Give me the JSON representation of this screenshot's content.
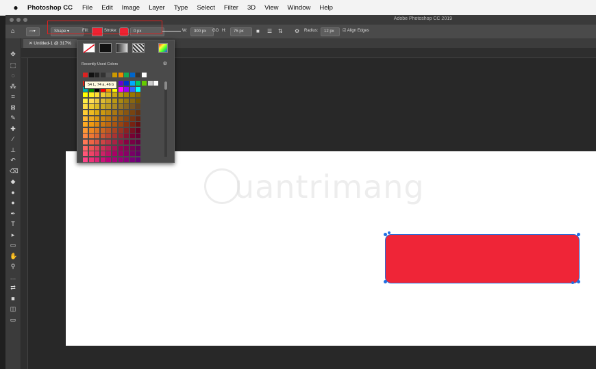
{
  "menubar": {
    "app_name": "Photoshop CC",
    "items": [
      "File",
      "Edit",
      "Image",
      "Layer",
      "Type",
      "Select",
      "Filter",
      "3D",
      "View",
      "Window",
      "Help"
    ]
  },
  "window": {
    "title": "Adobe Photoshop CC 2019"
  },
  "options_bar": {
    "mode_select": "Shape",
    "fill_label": "Fill:",
    "fill_color": "#ee2233",
    "stroke_label": "Stroke:",
    "stroke_color": "#ee2233",
    "stroke_width": "0 px",
    "width_label": "W:",
    "width_value": "300 px",
    "link_label": "GO",
    "height_label": "H:",
    "height_value": "75 px",
    "radius_label": "Radius:",
    "radius_value": "12 px",
    "align_edges_label": "Align Edges"
  },
  "document_tab": {
    "label": "Untitled-1 @ 317%"
  },
  "color_popup": {
    "recent_label": "Recently Used Colors",
    "tooltip": "54 L, 74 a, 46 b",
    "recent_colors": [
      "#d22",
      "#111",
      "#222",
      "#333",
      "#555",
      "#c90",
      "#e80",
      "#1a5",
      "#06c",
      "#333",
      "#fff"
    ],
    "palette_rows": [
      [
        "#e21",
        "#f60",
        "#fc0",
        "#ff0",
        "#f0c",
        "#c0f",
        "#60c",
        "#03c",
        "#0af",
        "#0c6",
        "#6c0",
        "#ccc",
        "#fff",
        "#000",
        "#fa0"
      ],
      [
        "#0aa",
        "#080",
        "#000",
        "#f00",
        "#f90",
        "#ff0",
        "#f0f",
        "#90f",
        "#36f",
        "#0ff"
      ],
      [
        "#ff0",
        "#fe2",
        "#fd3",
        "#ec3",
        "#db2",
        "#ca1",
        "#b91",
        "#a80",
        "#970",
        "#860"
      ],
      [
        "#fe4",
        "#fd5",
        "#ec4",
        "#db3",
        "#ca2",
        "#b91",
        "#a81",
        "#971",
        "#861",
        "#750"
      ],
      [
        "#fd4",
        "#ec3",
        "#db2",
        "#ca2",
        "#b92",
        "#a82",
        "#972",
        "#862",
        "#752",
        "#642"
      ],
      [
        "#fc3",
        "#eb2",
        "#da1",
        "#c91",
        "#b81",
        "#a71",
        "#961",
        "#851",
        "#741",
        "#631"
      ],
      [
        "#fb3",
        "#ea2",
        "#d91",
        "#c81",
        "#b71",
        "#a61",
        "#951",
        "#841",
        "#731",
        "#621"
      ],
      [
        "#fa2",
        "#e91",
        "#d81",
        "#c71",
        "#b61",
        "#a51",
        "#941",
        "#831",
        "#721",
        "#611"
      ],
      [
        "#f93",
        "#e82",
        "#d72",
        "#c62",
        "#b52",
        "#a42",
        "#932",
        "#822",
        "#712",
        "#602"
      ],
      [
        "#f84",
        "#e73",
        "#d63",
        "#c53",
        "#b43",
        "#a33",
        "#923",
        "#813",
        "#703",
        "#603"
      ],
      [
        "#f75",
        "#e64",
        "#d54",
        "#c44",
        "#b34",
        "#a24",
        "#914",
        "#804",
        "#704",
        "#604"
      ],
      [
        "#f66",
        "#e55",
        "#d45",
        "#c35",
        "#b25",
        "#a15",
        "#905",
        "#805",
        "#705",
        "#605"
      ],
      [
        "#f57",
        "#e46",
        "#d36",
        "#c26",
        "#b16",
        "#a06",
        "#906",
        "#806",
        "#706",
        "#606"
      ],
      [
        "#f48",
        "#e37",
        "#d27",
        "#c17",
        "#b07",
        "#a07",
        "#907",
        "#807",
        "#707",
        "#607"
      ]
    ]
  },
  "canvas": {
    "background": "#ffffff",
    "shape_fill": "#ef2537",
    "watermark": "uantrimang"
  },
  "toolbar": {
    "tools": [
      "move-tool-icon",
      "marquee-tool-icon",
      "lasso-tool-icon",
      "magic-wand-icon",
      "crop-tool-icon",
      "frame-tool-icon",
      "eyedropper-icon",
      "healing-brush-icon",
      "brush-tool-icon",
      "clone-stamp-icon",
      "history-brush-icon",
      "eraser-icon",
      "paint-bucket-icon",
      "blur-tool-icon",
      "dodge-tool-icon",
      "pen-tool-icon",
      "type-tool-icon",
      "path-selection-icon",
      "rectangle-tool-icon",
      "hand-tool-icon",
      "zoom-tool-icon",
      "more-tools-icon",
      "swap-colors-icon",
      "color-swatches-icon",
      "quick-mask-icon",
      "screen-mode-icon"
    ],
    "glyphs": [
      "✥",
      "⬚",
      "◌",
      "⁂",
      "⌗",
      "⊠",
      "✎",
      "✚",
      "⁄",
      "⊥",
      "↶",
      "⌫",
      "◆",
      "●",
      "●",
      "✒",
      "T",
      "▸",
      "▭",
      "✋",
      "⚲",
      "…",
      "⇄",
      "■",
      "◫",
      "▭"
    ]
  }
}
